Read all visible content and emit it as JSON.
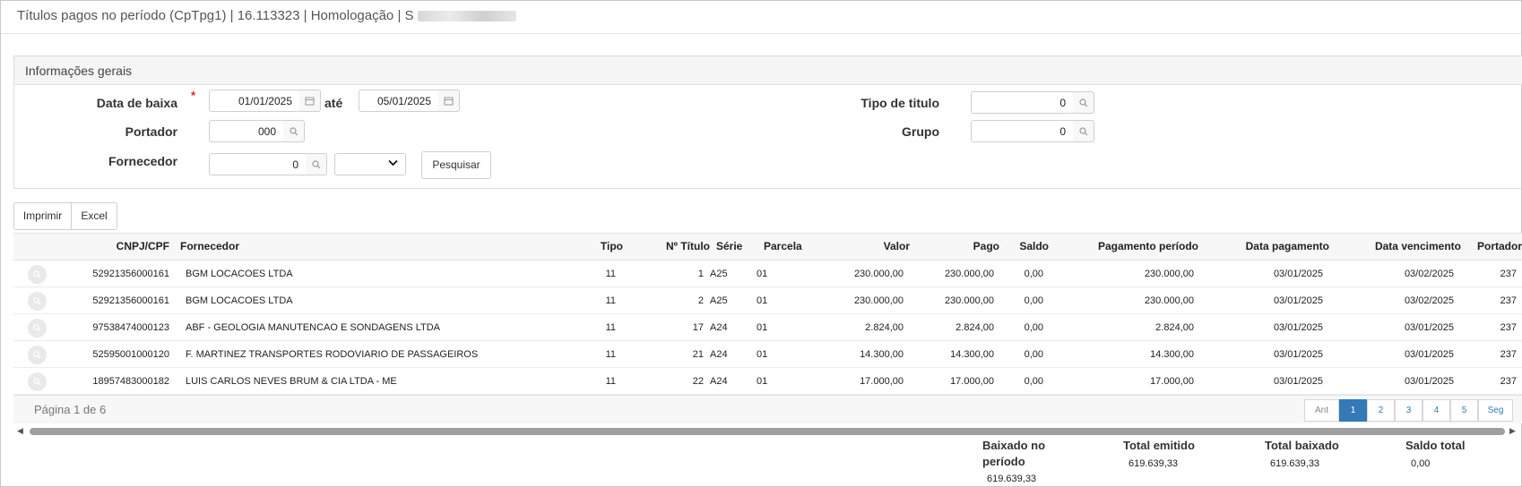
{
  "window": {
    "title": "Títulos pagos no período (CpTpg1) | 16.113323 | Homologação | S"
  },
  "panel": {
    "title": "Informações gerais",
    "data_baixa_label": "Data de baixa",
    "required_mark": "*",
    "data_baixa_from": "01/01/2025",
    "ate_label": "até",
    "data_baixa_to": "05/01/2025",
    "tipo_titulo_label": "Tipo de titulo",
    "tipo_titulo_value": "0",
    "portador_label": "Portador",
    "portador_value": "000",
    "grupo_label": "Grupo",
    "grupo_value": "0",
    "fornecedor_label": "Fornecedor",
    "fornecedor_value": "0",
    "fornecedor_select": "",
    "pesquisar_label": "Pesquisar"
  },
  "toolbar": {
    "imprimir_label": "Imprimir",
    "excel_label": "Excel"
  },
  "grid": {
    "columns": {
      "cnpj": "CNPJ/CPF",
      "fornecedor": "Fornecedor",
      "tipo": "Tipo",
      "numero": "Nº Título",
      "serie": "Série",
      "parcela": "Parcela",
      "valor": "Valor",
      "pago": "Pago",
      "saldo": "Saldo",
      "pagamento_periodo": "Pagamento período",
      "data_pagamento": "Data pagamento",
      "data_vencimento": "Data vencimento",
      "portador": "Portador"
    },
    "rows": [
      {
        "cnpj": "52921356000161",
        "fornecedor": "BGM LOCACOES LTDA",
        "tipo": "11",
        "numero": "1",
        "serie": "A25",
        "parcela": "01",
        "valor": "230.000,00",
        "pago": "230.000,00",
        "saldo": "0,00",
        "pagamento_periodo": "230.000,00",
        "data_pagamento": "03/01/2025",
        "data_vencimento": "03/02/2025",
        "portador": "237"
      },
      {
        "cnpj": "52921356000161",
        "fornecedor": "BGM LOCACOES LTDA",
        "tipo": "11",
        "numero": "2",
        "serie": "A25",
        "parcela": "01",
        "valor": "230.000,00",
        "pago": "230.000,00",
        "saldo": "0,00",
        "pagamento_periodo": "230.000,00",
        "data_pagamento": "03/01/2025",
        "data_vencimento": "03/02/2025",
        "portador": "237"
      },
      {
        "cnpj": "97538474000123",
        "fornecedor": "ABF - GEOLOGIA MANUTENCAO E SONDAGENS LTDA",
        "tipo": "11",
        "numero": "17",
        "serie": "A24",
        "parcela": "01",
        "valor": "2.824,00",
        "pago": "2.824,00",
        "saldo": "0,00",
        "pagamento_periodo": "2.824,00",
        "data_pagamento": "03/01/2025",
        "data_vencimento": "03/01/2025",
        "portador": "237"
      },
      {
        "cnpj": "52595001000120",
        "fornecedor": "F. MARTINEZ TRANSPORTES RODOVIARIO DE PASSAGEIROS",
        "tipo": "11",
        "numero": "21",
        "serie": "A24",
        "parcela": "01",
        "valor": "14.300,00",
        "pago": "14.300,00",
        "saldo": "0,00",
        "pagamento_periodo": "14.300,00",
        "data_pagamento": "03/01/2025",
        "data_vencimento": "03/01/2025",
        "portador": "237"
      },
      {
        "cnpj": "18957483000182",
        "fornecedor": "LUIS CARLOS NEVES BRUM & CIA LTDA - ME",
        "tipo": "11",
        "numero": "22",
        "serie": "A24",
        "parcela": "01",
        "valor": "17.000,00",
        "pago": "17.000,00",
        "saldo": "0,00",
        "pagamento_periodo": "17.000,00",
        "data_pagamento": "03/01/2025",
        "data_vencimento": "03/01/2025",
        "portador": "237"
      }
    ]
  },
  "pager": {
    "info": "Página 1 de 6",
    "prev_label": "Ant",
    "pages": [
      "1",
      "2",
      "3",
      "4",
      "5"
    ],
    "next_label": "Seg",
    "current_page": "1"
  },
  "totals": {
    "baixado_label_1": "Baixado no",
    "baixado_label_2": "período",
    "baixado_value": "619.639,33",
    "emitido_label": "Total emitido",
    "emitido_value": "619.639,33",
    "total_baixado_label": "Total baixado",
    "total_baixado_value": "619.639,33",
    "saldo_label": "Saldo total",
    "saldo_value": "0,00"
  },
  "icons": {
    "calendar": "calendar-icon",
    "search": "search-icon",
    "chevron": "chevron-down-icon"
  },
  "colors": {
    "accent": "#337ab7",
    "required": "#e0262b"
  }
}
